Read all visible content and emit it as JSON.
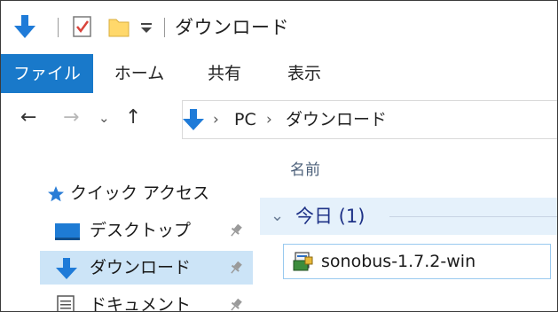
{
  "window": {
    "title": "ダウンロード"
  },
  "ribbon": {
    "tabs": [
      {
        "label": "ファイル",
        "active": true
      },
      {
        "label": "ホーム",
        "active": false
      },
      {
        "label": "共有",
        "active": false
      },
      {
        "label": "表示",
        "active": false
      }
    ]
  },
  "address": {
    "crumbs": [
      "PC",
      "ダウンロード"
    ]
  },
  "navpane": {
    "items": [
      {
        "label": "クイック アクセス",
        "icon": "star-icon"
      },
      {
        "label": "デスクトップ",
        "icon": "desktop-icon",
        "pinned": true
      },
      {
        "label": "ダウンロード",
        "icon": "download-arrow-icon",
        "pinned": true,
        "selected": true
      },
      {
        "label": "ドキュメント",
        "icon": "document-icon",
        "pinned": true
      }
    ]
  },
  "filelist": {
    "column_name": "名前",
    "group_label": "今日 (1)",
    "files": [
      {
        "name": "sonobus-1.7.2-win",
        "icon": "installer-icon"
      }
    ]
  },
  "colors": {
    "accent": "#1979ca",
    "selection": "#cce4f7",
    "group_bg": "#e5f1fb",
    "group_text": "#1e3287"
  }
}
